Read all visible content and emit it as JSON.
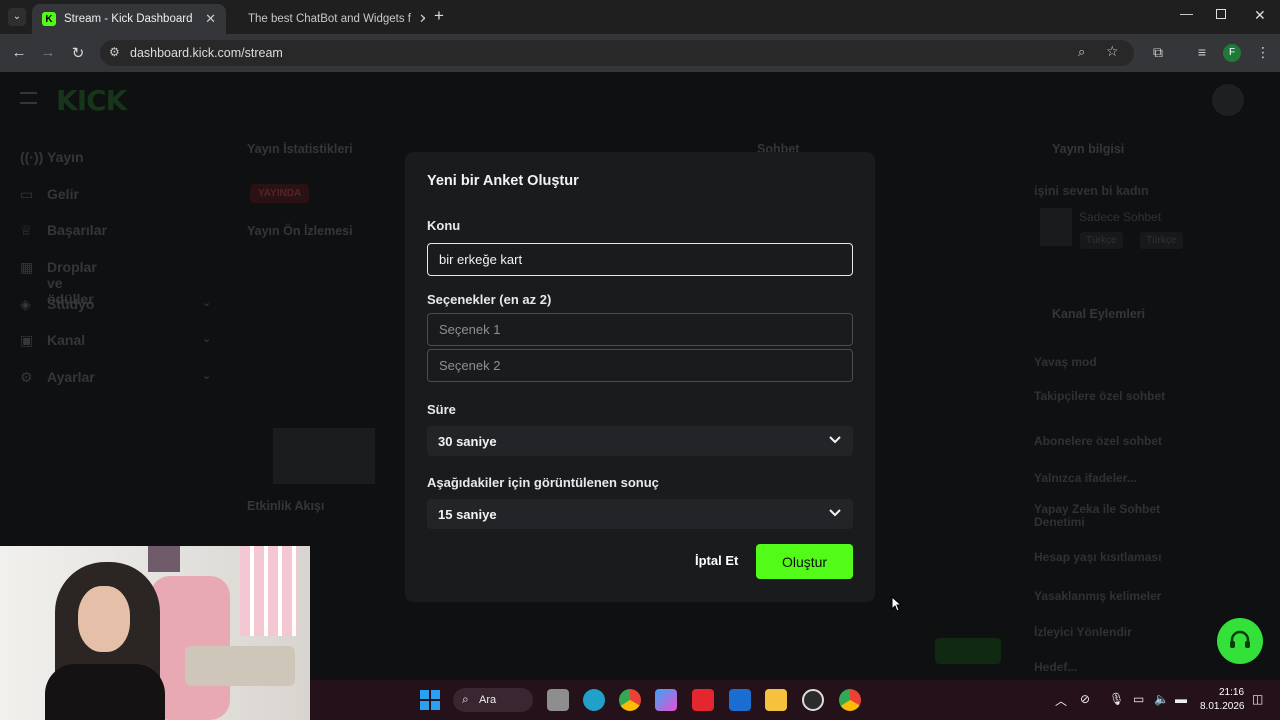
{
  "browser": {
    "tabs": [
      {
        "title": "Stream - Kick Dashboard",
        "active": true
      },
      {
        "title": "The best ChatBot and Widgets f",
        "active": false
      }
    ],
    "url": "dashboard.kick.com/stream",
    "profile_initial": "F"
  },
  "dashboard": {
    "logo": "KICK",
    "sidebar": [
      {
        "label": "Yayın",
        "icon": "broadcast-icon"
      },
      {
        "label": "Gelir",
        "icon": "wallet-icon"
      },
      {
        "label": "Başarılar",
        "icon": "trophy-icon"
      },
      {
        "label": "Droplar ve ödüller",
        "icon": "gift-icon"
      },
      {
        "label": "Stüdyo",
        "icon": "studio-icon"
      },
      {
        "label": "Kanal",
        "icon": "channel-icon"
      },
      {
        "label": "Ayarlar",
        "icon": "settings-icon"
      }
    ],
    "panels": {
      "stats": "Yayın İstatistikleri",
      "live_badge": "YAYINDA",
      "preview": "Yayın Ön İzlemesi",
      "activity": "Etkinlik Akışı",
      "chat": "Sohbet",
      "info": "Yayın bilgisi",
      "info_title": "işini seven bi kadın",
      "info_category": "Sadece Sohbet",
      "info_tags": [
        "Türkçe",
        "Türkçe"
      ],
      "channel_actions": "Kanal Eylemleri",
      "actions": [
        "Yavaş mod",
        "Takipçilere özel sohbet",
        "Abonelere özel sohbet",
        "Yalnızca ifadeler...",
        "Yapay Zeka ile Sohbet Denetimi",
        "Hesap yaşı kısıtlaması",
        "Yasaklanmış kelimeler",
        "İzleyici Yönlendir",
        "Hedef..."
      ]
    }
  },
  "modal": {
    "title": "Yeni bir Anket Oluştur",
    "topic_label": "Konu",
    "topic_value": "bir erkeğe kart",
    "options_label": "Seçenekler (en az 2)",
    "option1_placeholder": "Seçenek 1",
    "option2_placeholder": "Seçenek 2",
    "duration_label": "Süre",
    "duration_value": "30 saniye",
    "result_label": "Aşağıdakiler için görüntülenen sonuç",
    "result_value": "15 saniye",
    "cancel_label": "İptal Et",
    "create_label": "Oluştur",
    "accent": "#53fc18"
  },
  "taskbar": {
    "search_label": "Ara",
    "time": "21:16",
    "date": "8.01.2026"
  }
}
